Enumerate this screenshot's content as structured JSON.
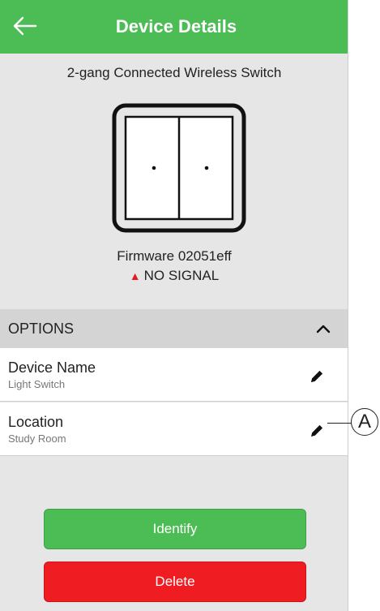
{
  "header": {
    "title": "Device Details",
    "back_icon": "arrow-left-icon"
  },
  "device": {
    "title": "2-gang Connected Wireless Switch",
    "firmware": "Firmware 02051eff",
    "signal": "NO SIGNAL",
    "signal_icon": "warning-triangle-icon"
  },
  "options": {
    "label": "OPTIONS",
    "expanded": true,
    "items": [
      {
        "label": "Device Name",
        "value": "Light Switch",
        "edit_icon": "pencil-icon"
      },
      {
        "label": "Location",
        "value": "Study Room",
        "edit_icon": "pencil-icon"
      }
    ]
  },
  "buttons": {
    "identify": "Identify",
    "delete": "Delete"
  },
  "callout": {
    "label": "A"
  },
  "colors": {
    "header": "#4cbc54",
    "identify": "#4cbc54",
    "delete": "#ef1c22",
    "warning": "#e31b23",
    "background": "#e6e6e6"
  }
}
